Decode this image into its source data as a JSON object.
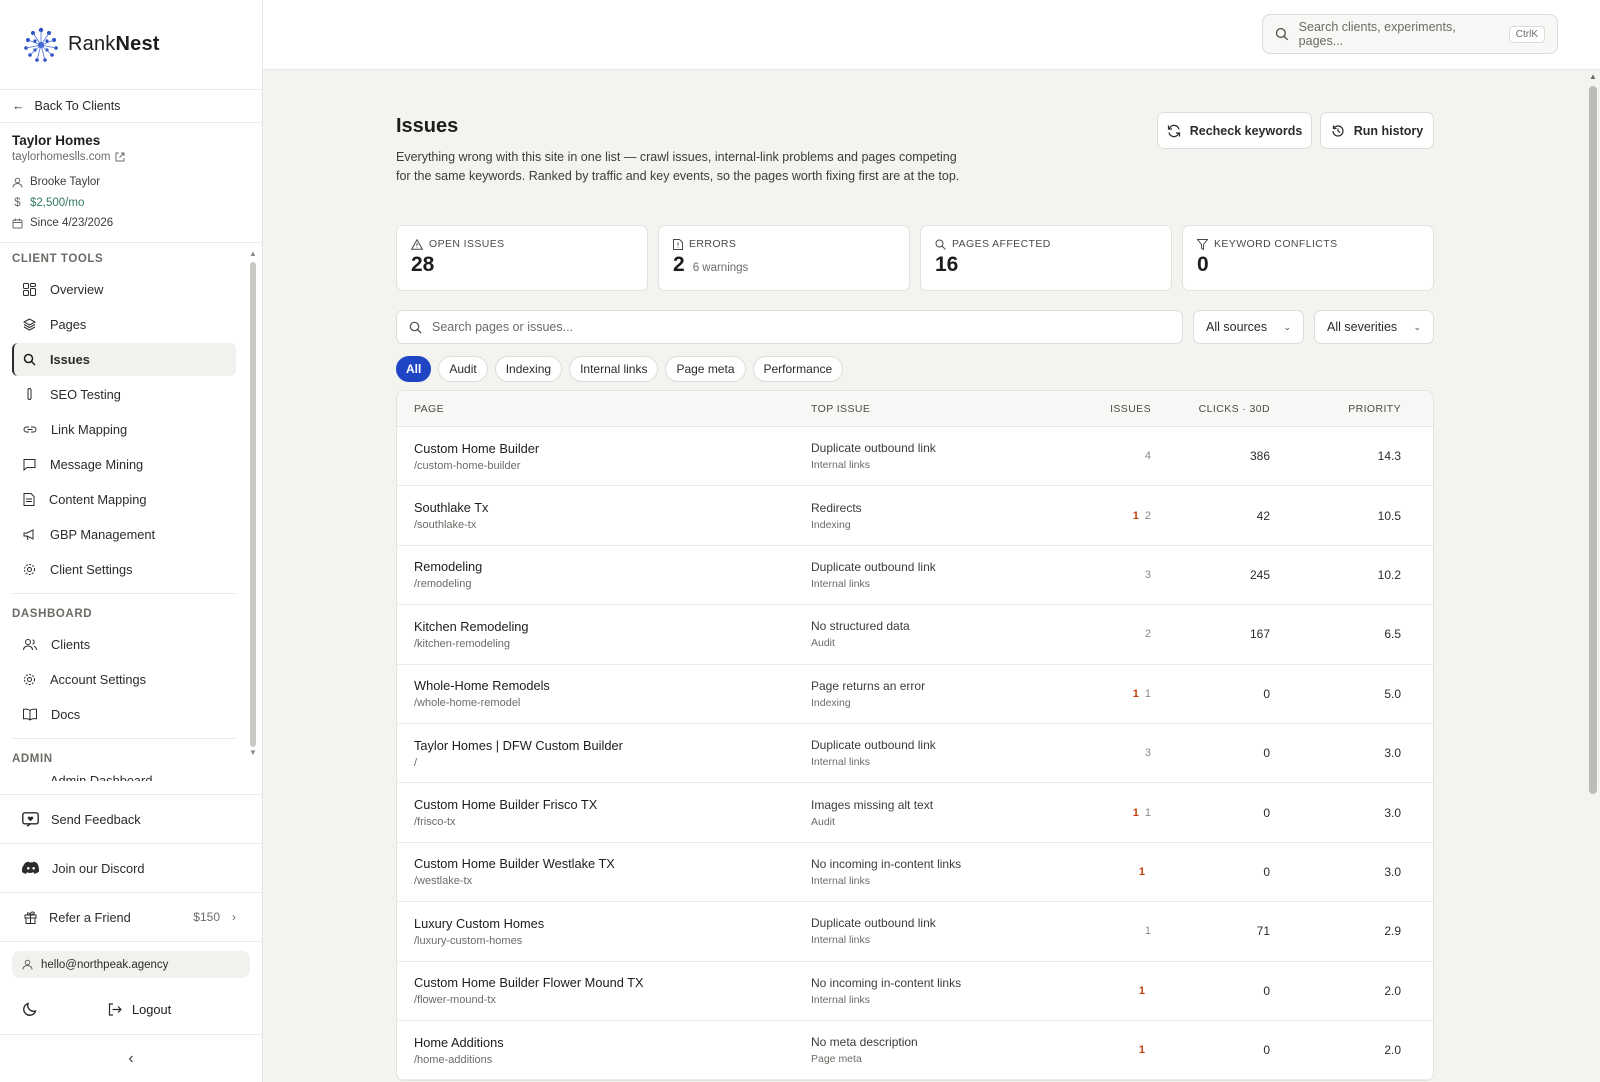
{
  "brand": {
    "prefix": "Rank",
    "suffix": "Nest"
  },
  "back_label": "Back To Clients",
  "client": {
    "name": "Taylor Homes",
    "site": "taylorhomeslls.com",
    "owner": "Brooke Taylor",
    "retainer": "$2,500/mo",
    "since": "Since 4/23/2026"
  },
  "nav": {
    "client_tools_title": "CLIENT TOOLS",
    "client_tools": [
      "Overview",
      "Pages",
      "Issues",
      "SEO Testing",
      "Link Mapping",
      "Message Mining",
      "Content Mapping",
      "GBP Management",
      "Client Settings"
    ],
    "dashboard_title": "DASHBOARD",
    "dashboard": [
      "Clients",
      "Account Settings",
      "Docs"
    ],
    "admin_title": "ADMIN",
    "admin": [
      "Admin Dashboard"
    ]
  },
  "sidebar_bottom": {
    "feedback": "Send Feedback",
    "discord": "Join our Discord",
    "refer": "Refer a Friend",
    "refer_reward": "$150",
    "email": "hello@northpeak.agency",
    "logout": "Logout"
  },
  "search": {
    "placeholder": "Search clients, experiments, pages...",
    "shortcut": "CtrlK"
  },
  "page": {
    "title": "Issues",
    "subtitle": "Everything wrong with this site in one list — crawl issues, internal-link problems and pages competing for the same keywords. Ranked by traffic and key events, so the pages worth fixing first are at the top.",
    "recheck": "Recheck keywords",
    "history": "Run history"
  },
  "stats": {
    "open_label": "OPEN ISSUES",
    "open_value": "28",
    "errors_label": "ERRORS",
    "errors_value": "2",
    "errors_sub": "6 warnings",
    "pages_label": "PAGES AFFECTED",
    "pages_value": "16",
    "conflicts_label": "KEYWORD CONFLICTS",
    "conflicts_value": "0"
  },
  "filters": {
    "search_placeholder": "Search pages or issues...",
    "source": "All sources",
    "severity": "All severities"
  },
  "chips": [
    "All",
    "Audit",
    "Indexing",
    "Internal links",
    "Page meta",
    "Performance"
  ],
  "table": {
    "headers": {
      "page": "PAGE",
      "issue": "TOP ISSUE",
      "issues": "ISSUES",
      "clicks": "CLICKS · 30D",
      "priority": "PRIORITY"
    },
    "rows": [
      {
        "name": "Custom Home Builder",
        "path": "/custom-home-builder",
        "issue": "Duplicate outbound link",
        "category": "Internal links",
        "errors": "",
        "warnings": "4",
        "clicks": "386",
        "priority": "14.3"
      },
      {
        "name": "Southlake Tx",
        "path": "/southlake-tx",
        "issue": "Redirects",
        "category": "Indexing",
        "errors": "1",
        "warnings": "2",
        "clicks": "42",
        "priority": "10.5"
      },
      {
        "name": "Remodeling",
        "path": "/remodeling",
        "issue": "Duplicate outbound link",
        "category": "Internal links",
        "errors": "",
        "warnings": "3",
        "clicks": "245",
        "priority": "10.2"
      },
      {
        "name": "Kitchen Remodeling",
        "path": "/kitchen-remodeling",
        "issue": "No structured data",
        "category": "Audit",
        "errors": "",
        "warnings": "2",
        "clicks": "167",
        "priority": "6.5"
      },
      {
        "name": "Whole-Home Remodels",
        "path": "/whole-home-remodel",
        "issue": "Page returns an error",
        "category": "Indexing",
        "errors": "1",
        "warnings": "1",
        "clicks": "0",
        "priority": "5.0"
      },
      {
        "name": "Taylor Homes | DFW Custom Builder",
        "path": "/",
        "issue": "Duplicate outbound link",
        "category": "Internal links",
        "errors": "",
        "warnings": "3",
        "clicks": "0",
        "priority": "3.0"
      },
      {
        "name": "Custom Home Builder Frisco TX",
        "path": "/frisco-tx",
        "issue": "Images missing alt text",
        "category": "Audit",
        "errors": "1",
        "warnings": "1",
        "clicks": "0",
        "priority": "3.0"
      },
      {
        "name": "Custom Home Builder Westlake TX",
        "path": "/westlake-tx",
        "issue": "No incoming in-content links",
        "category": "Internal links",
        "errors": "1",
        "warnings": "",
        "clicks": "0",
        "priority": "3.0"
      },
      {
        "name": "Luxury Custom Homes",
        "path": "/luxury-custom-homes",
        "issue": "Duplicate outbound link",
        "category": "Internal links",
        "errors": "",
        "warnings": "1",
        "clicks": "71",
        "priority": "2.9"
      },
      {
        "name": "Custom Home Builder Flower Mound TX",
        "path": "/flower-mound-tx",
        "issue": "No incoming in-content links",
        "category": "Internal links",
        "errors": "1",
        "warnings": "",
        "clicks": "0",
        "priority": "2.0"
      },
      {
        "name": "Home Additions",
        "path": "/home-additions",
        "issue": "No meta description",
        "category": "Page meta",
        "errors": "1",
        "warnings": "",
        "clicks": "0",
        "priority": "2.0"
      }
    ]
  },
  "colors": {
    "accent": "#1f44c4",
    "error": "#c2410c",
    "money": "#2f7a5a"
  }
}
